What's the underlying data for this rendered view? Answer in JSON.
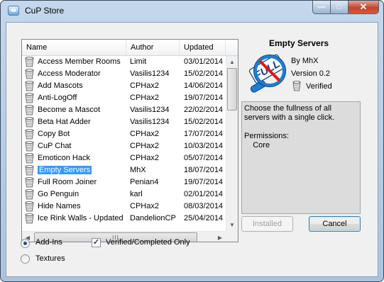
{
  "window": {
    "title": "CuP Store"
  },
  "caption_buttons": {
    "minimize": "—",
    "maximize": "□",
    "close": "✕"
  },
  "table": {
    "columns": [
      "Name",
      "Author",
      "Updated"
    ],
    "rows": [
      {
        "name": "Access Member Rooms",
        "author": "Limit",
        "updated": "03/01/2014"
      },
      {
        "name": "Access Moderator",
        "author": "Vasilis1234",
        "updated": "15/02/2014"
      },
      {
        "name": "Add Mascots",
        "author": "CPHax2",
        "updated": "14/06/2014"
      },
      {
        "name": "Anti-LogOff",
        "author": "CPHax2",
        "updated": "19/07/2014"
      },
      {
        "name": "Become a Mascot",
        "author": "Vasilis1234",
        "updated": "22/02/2014"
      },
      {
        "name": "Beta Hat Adder",
        "author": "Vasilis1234",
        "updated": "15/02/2014"
      },
      {
        "name": "Copy Bot",
        "author": "CPHax2",
        "updated": "17/07/2014"
      },
      {
        "name": "CuP Chat",
        "author": "CPHax2",
        "updated": "10/03/2014"
      },
      {
        "name": "Emoticon Hack",
        "author": "CPHax2",
        "updated": "05/07/2014"
      },
      {
        "name": "Empty Servers",
        "author": "MhX",
        "updated": "18/07/2014",
        "selected": true
      },
      {
        "name": "Full Room Joiner",
        "author": "Penian4",
        "updated": "19/07/2014"
      },
      {
        "name": "Go Penguin",
        "author": "karl",
        "updated": "02/01/2014"
      },
      {
        "name": "Hide Names",
        "author": "CPHax2",
        "updated": "08/03/2014"
      },
      {
        "name": "Ice Rink Walls - Updated",
        "author": "DandelionCP",
        "updated": "25/04/2014"
      }
    ]
  },
  "scrollbar": {
    "horizontal_grip": "III"
  },
  "detail": {
    "title": "Empty Servers",
    "logo_text": "FULL",
    "by": "By MhX",
    "version": "Version 0.2",
    "verified": "Verified",
    "description_lines": [
      "Choose the fullness of all",
      "servers with a single click.",
      "",
      "Permissions:",
      "    Core"
    ],
    "colors": {
      "logo_ring": "#1a7ed6",
      "logo_slash": "#e0151b"
    }
  },
  "buttons": {
    "installed": "Installed",
    "cancel": "Cancel"
  },
  "options": {
    "add_ins": {
      "label": "Add-Ins",
      "checked": true
    },
    "textures": {
      "label": "Textures",
      "checked": false
    },
    "verified_only": {
      "label": "Verified/Completed Only",
      "checked": true,
      "mark": "✓"
    }
  },
  "icons": {
    "row_icon": "cup-icon",
    "app_icon": "cup-store-icon"
  }
}
